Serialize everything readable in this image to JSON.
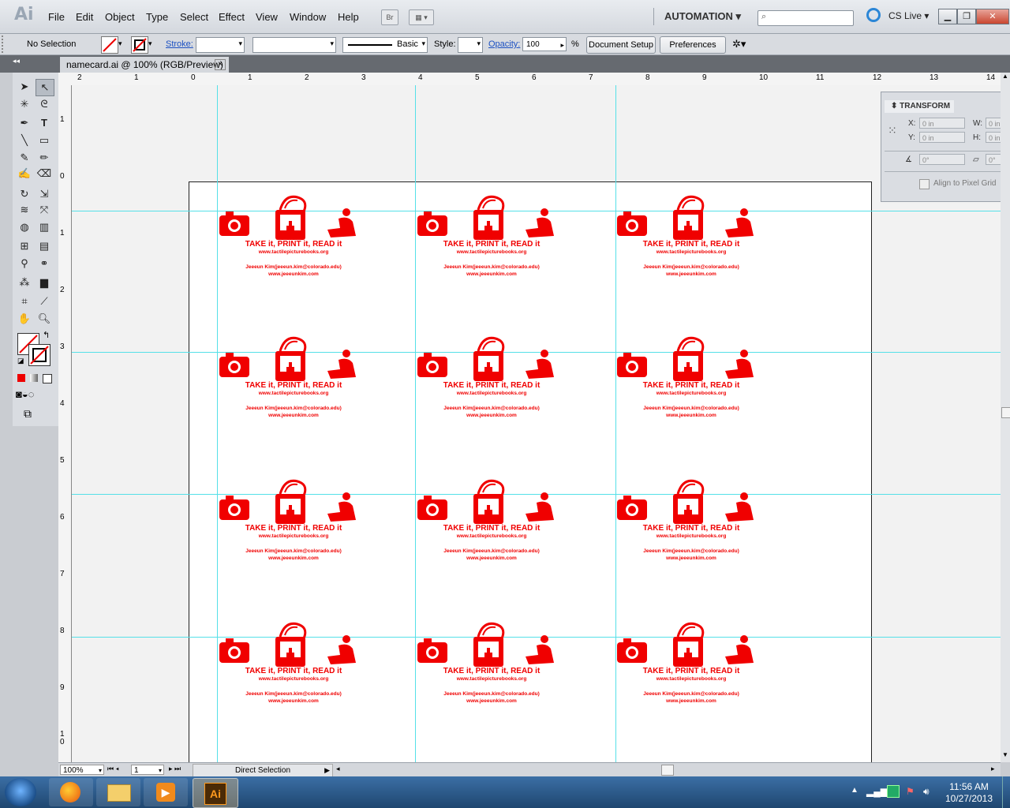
{
  "app": {
    "logo": "Ai",
    "bridge_button": "Br"
  },
  "menu": {
    "items": [
      "File",
      "Edit",
      "Object",
      "Type",
      "Select",
      "Effect",
      "View",
      "Window",
      "Help"
    ]
  },
  "workspace": {
    "label": "AUTOMATION",
    "search_placeholder": ""
  },
  "cs_live": {
    "label": "CS Live"
  },
  "control_bar": {
    "selection": "No Selection",
    "stroke_label": "Stroke:",
    "brush_label": "Basic",
    "style_label": "Style:",
    "opacity_label": "Opacity:",
    "opacity_value": "100",
    "opacity_unit": "%",
    "doc_setup_button": "Document Setup",
    "preferences_button": "Preferences"
  },
  "document_tab": {
    "title": "namecard.ai @ 100% (RGB/Preview)",
    "close": "×"
  },
  "ruler": {
    "h_numbers": [
      "2",
      "1",
      "0",
      "1",
      "2",
      "3",
      "4",
      "5",
      "6",
      "7",
      "8",
      "9",
      "10",
      "11",
      "12",
      "13",
      "14"
    ],
    "v_numbers": [
      "1",
      "0",
      "1",
      "2",
      "3",
      "4",
      "5",
      "6",
      "7",
      "8",
      "9",
      "1\n0"
    ]
  },
  "card": {
    "tagline": "TAKE it, PRINT it, READ it",
    "website1": "www.tactilepicturebooks.org",
    "contact": "Jeeeun Kim(jeeeun.kim@colorado.edu)",
    "website2": "www.jeeeunkim.com"
  },
  "transform_panel": {
    "title": "TRANSFORM",
    "x_label": "X:",
    "x_value": "0 in",
    "y_label": "Y:",
    "y_value": "0 in",
    "w_label": "W:",
    "w_value": "0 in",
    "h_label": "H:",
    "h_value": "0 in",
    "angle_value": "0°",
    "shear_value": "0°",
    "align_pixel_grid": "Align to Pixel Grid"
  },
  "status_bar": {
    "zoom": "100%",
    "artboard": "1",
    "tool": "Direct Selection"
  },
  "taskbar": {
    "time": "11:56 AM",
    "date": "10/27/2013",
    "ai_icon": "Ai"
  },
  "colors": {
    "card_red": "#f00000",
    "guide": "#55e0e8"
  }
}
